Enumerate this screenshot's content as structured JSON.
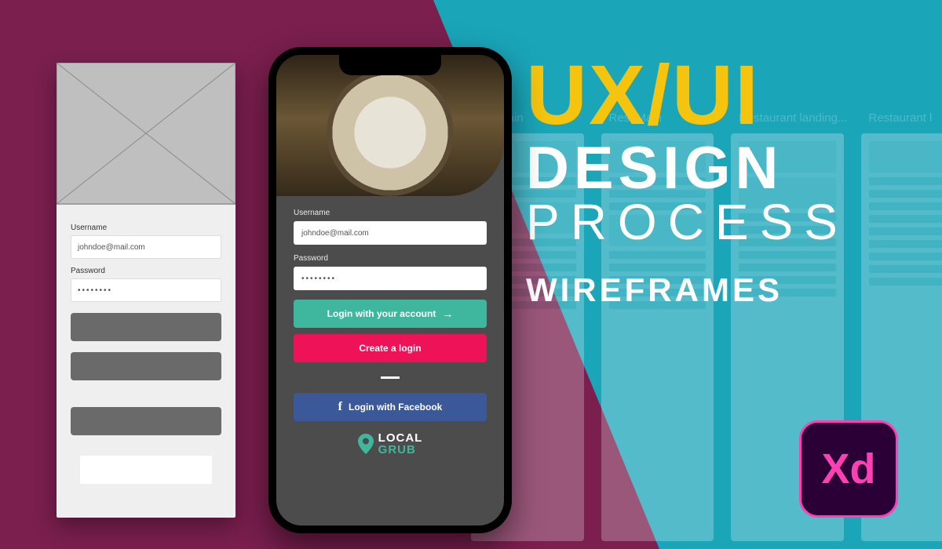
{
  "title": {
    "line1": "UX/UI",
    "line2": "DESIGN",
    "line3": "PROCESS",
    "line4": "WIREFRAMES"
  },
  "xd_badge": {
    "label": "Xd"
  },
  "bg_boards": {
    "labels": [
      "est Main",
      "Rest Main",
      "Restaurant landing...",
      "Restaurant l"
    ]
  },
  "wireframe": {
    "username_label": "Username",
    "username_value": "johndoe@mail.com",
    "password_label": "Password",
    "password_value": "••••••••"
  },
  "phone": {
    "username_label": "Username",
    "username_value": "johndoe@mail.com",
    "password_label": "Password",
    "password_value": "••••••••",
    "login_button": "Login with your account",
    "login_arrow": "→",
    "create_button": "Create a login",
    "fb_button": "Login with Facebook",
    "fb_icon": "f",
    "brand_line1": "LOCAL",
    "brand_line2": "GRUB"
  }
}
